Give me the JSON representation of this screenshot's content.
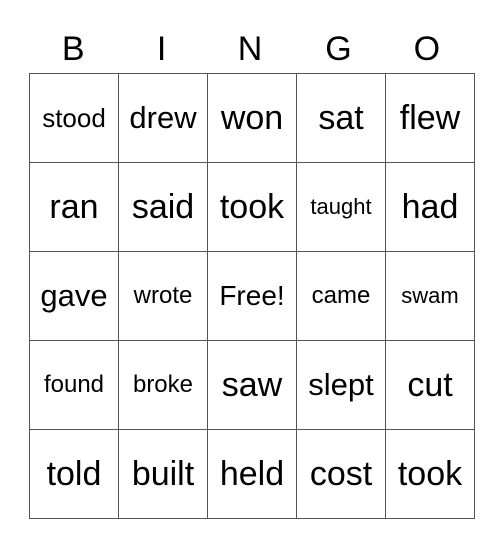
{
  "header": {
    "letters": [
      "B",
      "I",
      "N",
      "G",
      "O"
    ]
  },
  "card": {
    "rows": [
      [
        "stood",
        "drew",
        "won",
        "sat",
        "flew"
      ],
      [
        "ran",
        "said",
        "took",
        "taught",
        "had"
      ],
      [
        "gave",
        "wrote",
        "Free!",
        "came",
        "swam"
      ],
      [
        "found",
        "broke",
        "saw",
        "slept",
        "cut"
      ],
      [
        "told",
        "built",
        "held",
        "cost",
        "took"
      ]
    ]
  }
}
